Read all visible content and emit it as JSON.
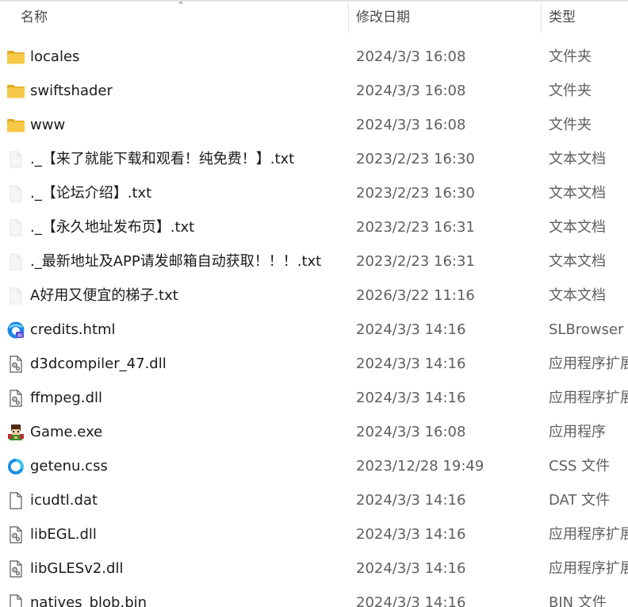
{
  "columns": {
    "name": "名称",
    "date": "修改日期",
    "type": "类型"
  },
  "files": [
    {
      "name": "locales",
      "date": "2024/3/3 16:08",
      "type": "文件夹",
      "icon": "folder-icon"
    },
    {
      "name": "swiftshader",
      "date": "2024/3/3 16:08",
      "type": "文件夹",
      "icon": "folder-icon"
    },
    {
      "name": "www",
      "date": "2024/3/3 16:08",
      "type": "文件夹",
      "icon": "folder-icon"
    },
    {
      "name": "._【来了就能下载和观看！纯免费！】.txt",
      "date": "2023/2/23 16:30",
      "type": "文本文档",
      "icon": "text-file-icon"
    },
    {
      "name": "._【论坛介绍】.txt",
      "date": "2023/2/23 16:30",
      "type": "文本文档",
      "icon": "text-file-icon"
    },
    {
      "name": "._【永久地址发布页】.txt",
      "date": "2023/2/23 16:31",
      "type": "文本文档",
      "icon": "text-file-icon"
    },
    {
      "name": "._最新地址及APP请发邮箱自动获取！！！.txt",
      "date": "2023/2/23 16:31",
      "type": "文本文档",
      "icon": "text-file-icon"
    },
    {
      "name": "A好用又便宜的梯子.txt",
      "date": "2026/3/22 11:16",
      "type": "文本文档",
      "icon": "text-file-icon"
    },
    {
      "name": "credits.html",
      "date": "2024/3/3 14:16",
      "type": "SLBrowser H",
      "icon": "browser-icon"
    },
    {
      "name": "d3dcompiler_47.dll",
      "date": "2024/3/3 14:16",
      "type": "应用程序扩展",
      "icon": "dll-file-icon"
    },
    {
      "name": "ffmpeg.dll",
      "date": "2024/3/3 14:16",
      "type": "应用程序扩展",
      "icon": "dll-file-icon"
    },
    {
      "name": "Game.exe",
      "date": "2024/3/3 16:08",
      "type": "应用程序",
      "icon": "game-exe-icon"
    },
    {
      "name": "getenu.css",
      "date": "2023/12/28 19:49",
      "type": "CSS 文件",
      "icon": "css-file-icon"
    },
    {
      "name": "icudtl.dat",
      "date": "2024/3/3 14:16",
      "type": "DAT 文件",
      "icon": "blank-file-icon"
    },
    {
      "name": "libEGL.dll",
      "date": "2024/3/3 14:16",
      "type": "应用程序扩展",
      "icon": "dll-file-icon"
    },
    {
      "name": "libGLESv2.dll",
      "date": "2024/3/3 14:16",
      "type": "应用程序扩展",
      "icon": "dll-file-icon"
    },
    {
      "name": "natives_blob.bin",
      "date": "2024/3/3 14:16",
      "type": "BIN 文件",
      "icon": "blank-file-icon"
    }
  ],
  "colors": {
    "folder": "#f7c948",
    "folder_dark": "#e2aa22",
    "text": "#1a1a1a",
    "muted": "#5f5f5f"
  }
}
